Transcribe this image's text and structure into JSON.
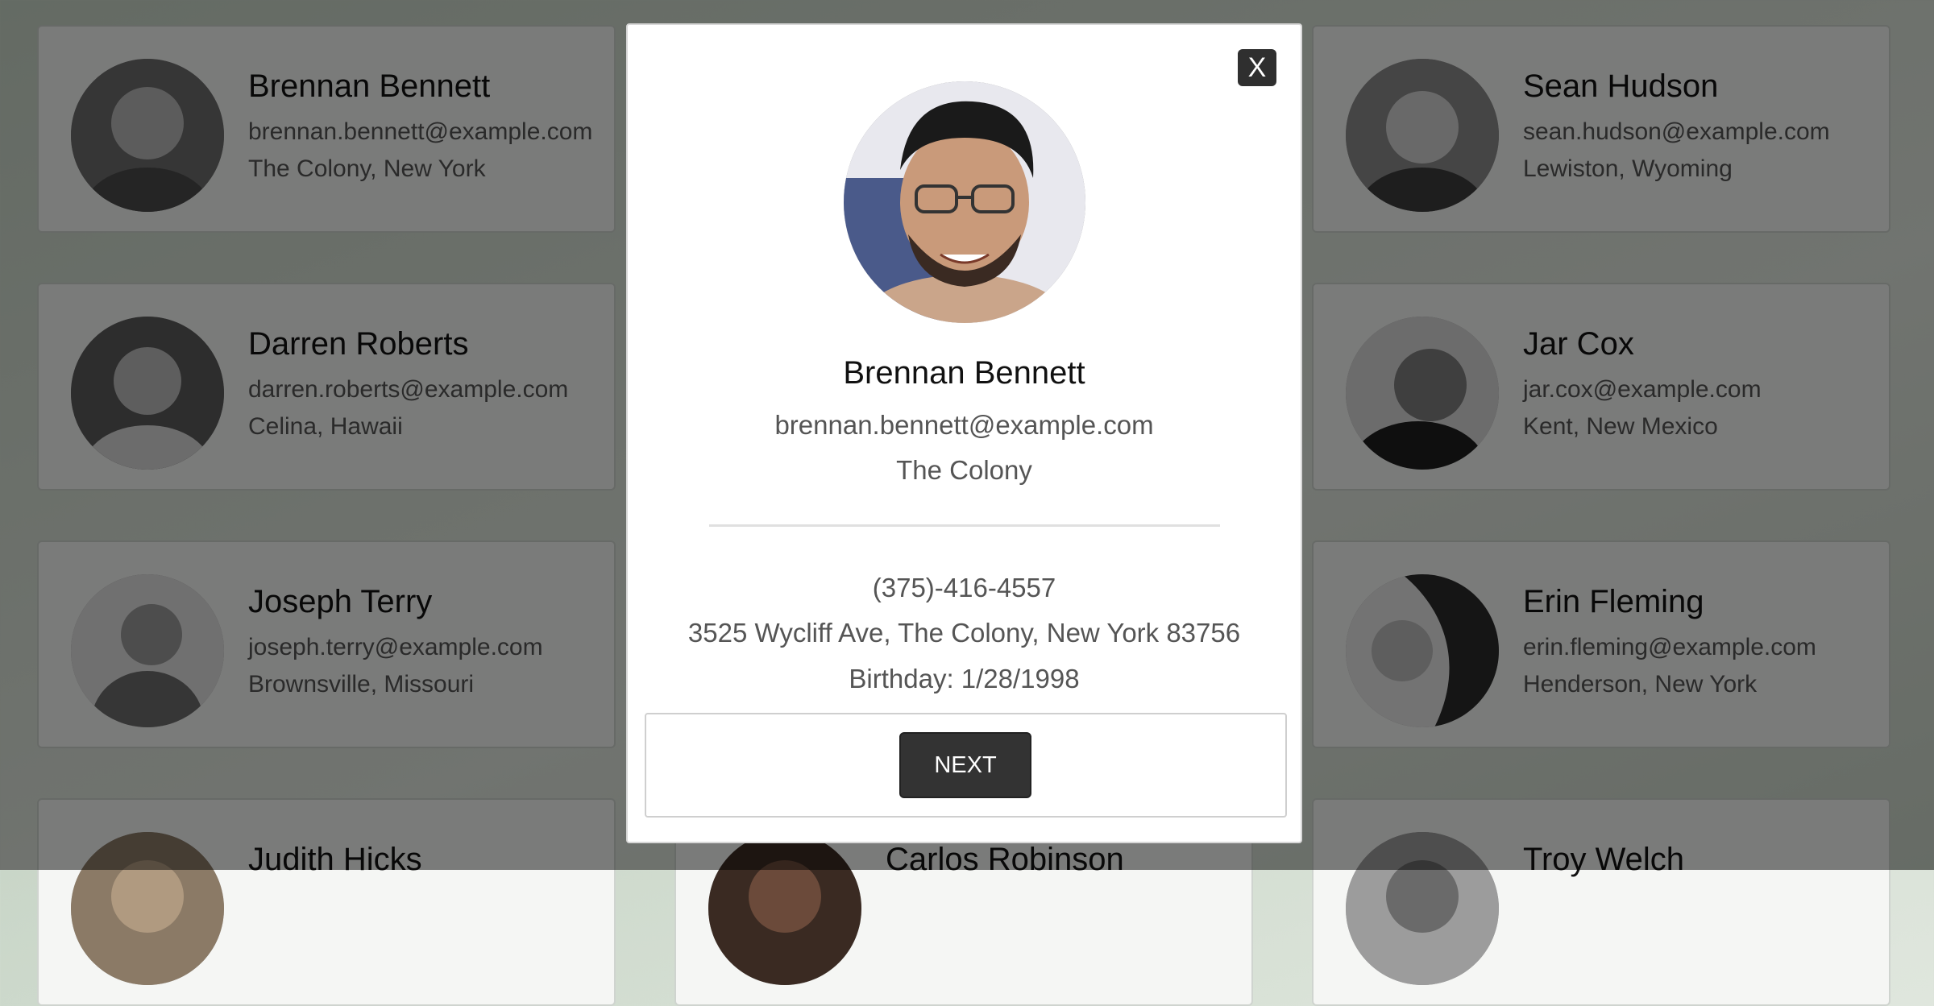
{
  "cards": [
    {
      "name": "Brennan Bennett",
      "email": "brennan.bennett@example.com",
      "location": "The Colony, New York"
    },
    {
      "name": "",
      "email": "",
      "location": ""
    },
    {
      "name": "Sean Hudson",
      "email": "sean.hudson@example.com",
      "location": "Lewiston, Wyoming"
    },
    {
      "name": "Darren Roberts",
      "email": "darren.roberts@example.com",
      "location": "Celina, Hawaii"
    },
    {
      "name": "",
      "email": "",
      "location": ""
    },
    {
      "name": "Jar Cox",
      "email": "jar.cox@example.com",
      "location": "Kent, New Mexico"
    },
    {
      "name": "Joseph Terry",
      "email": "joseph.terry@example.com",
      "location": "Brownsville, Missouri"
    },
    {
      "name": "",
      "email": "",
      "location": ""
    },
    {
      "name": "Erin Fleming",
      "email": "erin.fleming@example.com",
      "location": "Henderson, New York"
    },
    {
      "name": "Judith Hicks",
      "email": "",
      "location": ""
    },
    {
      "name": "Carlos Robinson",
      "email": "",
      "location": ""
    },
    {
      "name": "Troy Welch",
      "email": "",
      "location": ""
    }
  ],
  "modal": {
    "close_label": "X",
    "name": "Brennan Bennett",
    "email": "brennan.bennett@example.com",
    "city": "The Colony",
    "phone": "(375)-416-4557",
    "address": "3525 Wycliff Ave, The Colony, New York 83756",
    "birthday": "Birthday: 1/28/1998",
    "next_label": "NEXT"
  }
}
